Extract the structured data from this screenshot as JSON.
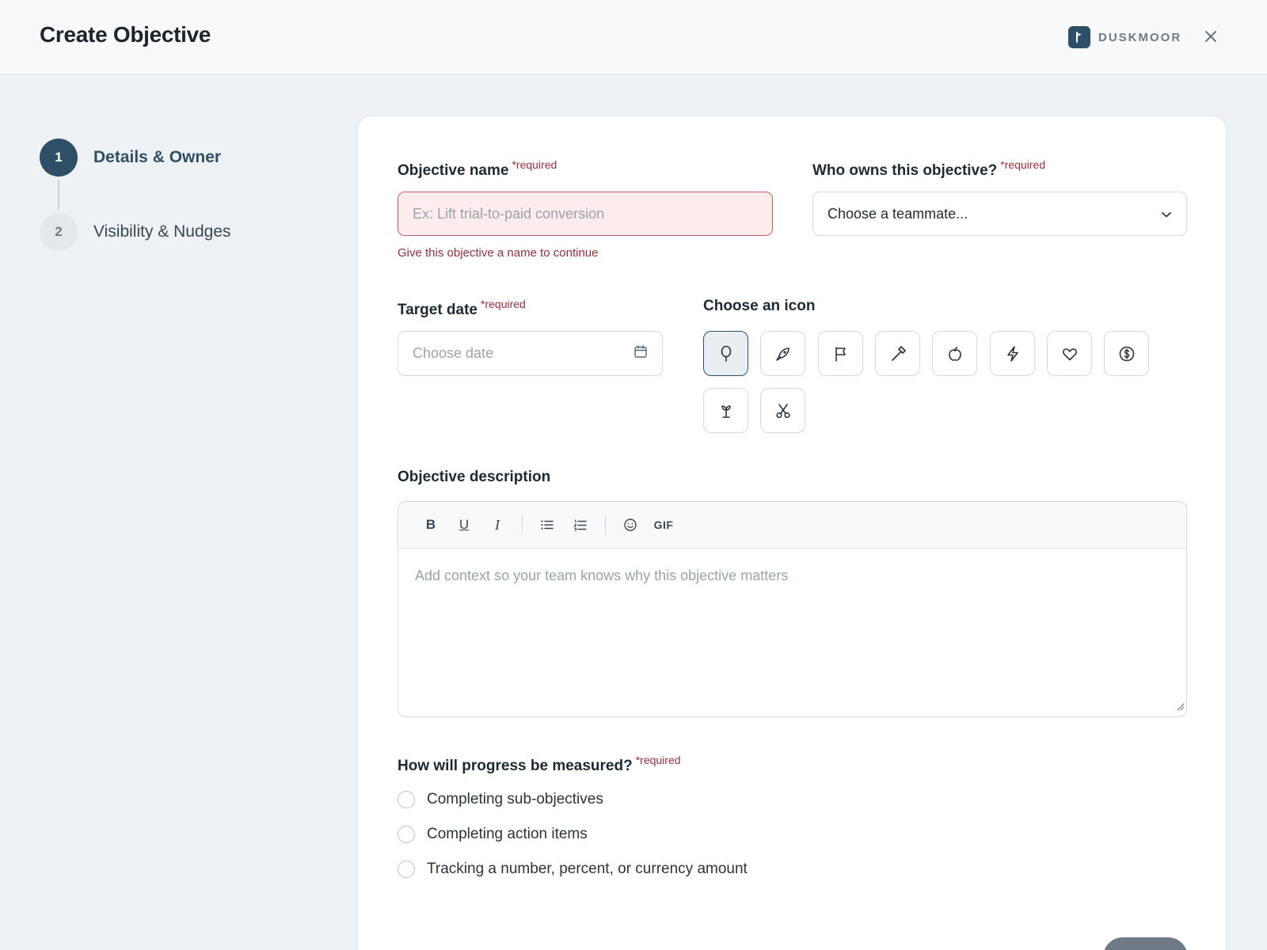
{
  "header": {
    "title": "Create Objective",
    "brand_name": "DUSKMOOR"
  },
  "stepper": {
    "steps": [
      {
        "number": "1",
        "label": "Details & Owner"
      },
      {
        "number": "2",
        "label": "Visibility & Nudges"
      }
    ]
  },
  "form": {
    "required_marker": "*required",
    "name": {
      "label": "Objective name",
      "placeholder": "Ex: Lift trial-to-paid conversion",
      "error": "Give this objective a name to continue"
    },
    "owner": {
      "label": "Who owns this objective?",
      "value": "Choose a teammate..."
    },
    "target_date": {
      "label": "Target date",
      "placeholder": "Choose date"
    },
    "icon_picker": {
      "label": "Choose an icon",
      "icons": [
        "balloon-icon",
        "rocket-icon",
        "flag-icon",
        "hammer-icon",
        "apple-icon",
        "lightning-icon",
        "heart-icon",
        "dollar-coin-icon",
        "plant-icon",
        "scissors-icon"
      ],
      "selected": "balloon-icon"
    },
    "description": {
      "label": "Objective description",
      "placeholder": "Add context so your team knows why this objective matters",
      "toolbar": {
        "bold": "B",
        "underline": "U",
        "italic": "I",
        "gif": "GIF"
      }
    },
    "progress": {
      "label": "How will progress be measured?",
      "options": [
        "Completing sub-objectives",
        "Completing action items",
        "Tracking a number, percent, or currency amount"
      ]
    }
  },
  "colors": {
    "accent": "#2f4f66",
    "error": "#9b2c3c",
    "error_bg": "#fcecee"
  }
}
